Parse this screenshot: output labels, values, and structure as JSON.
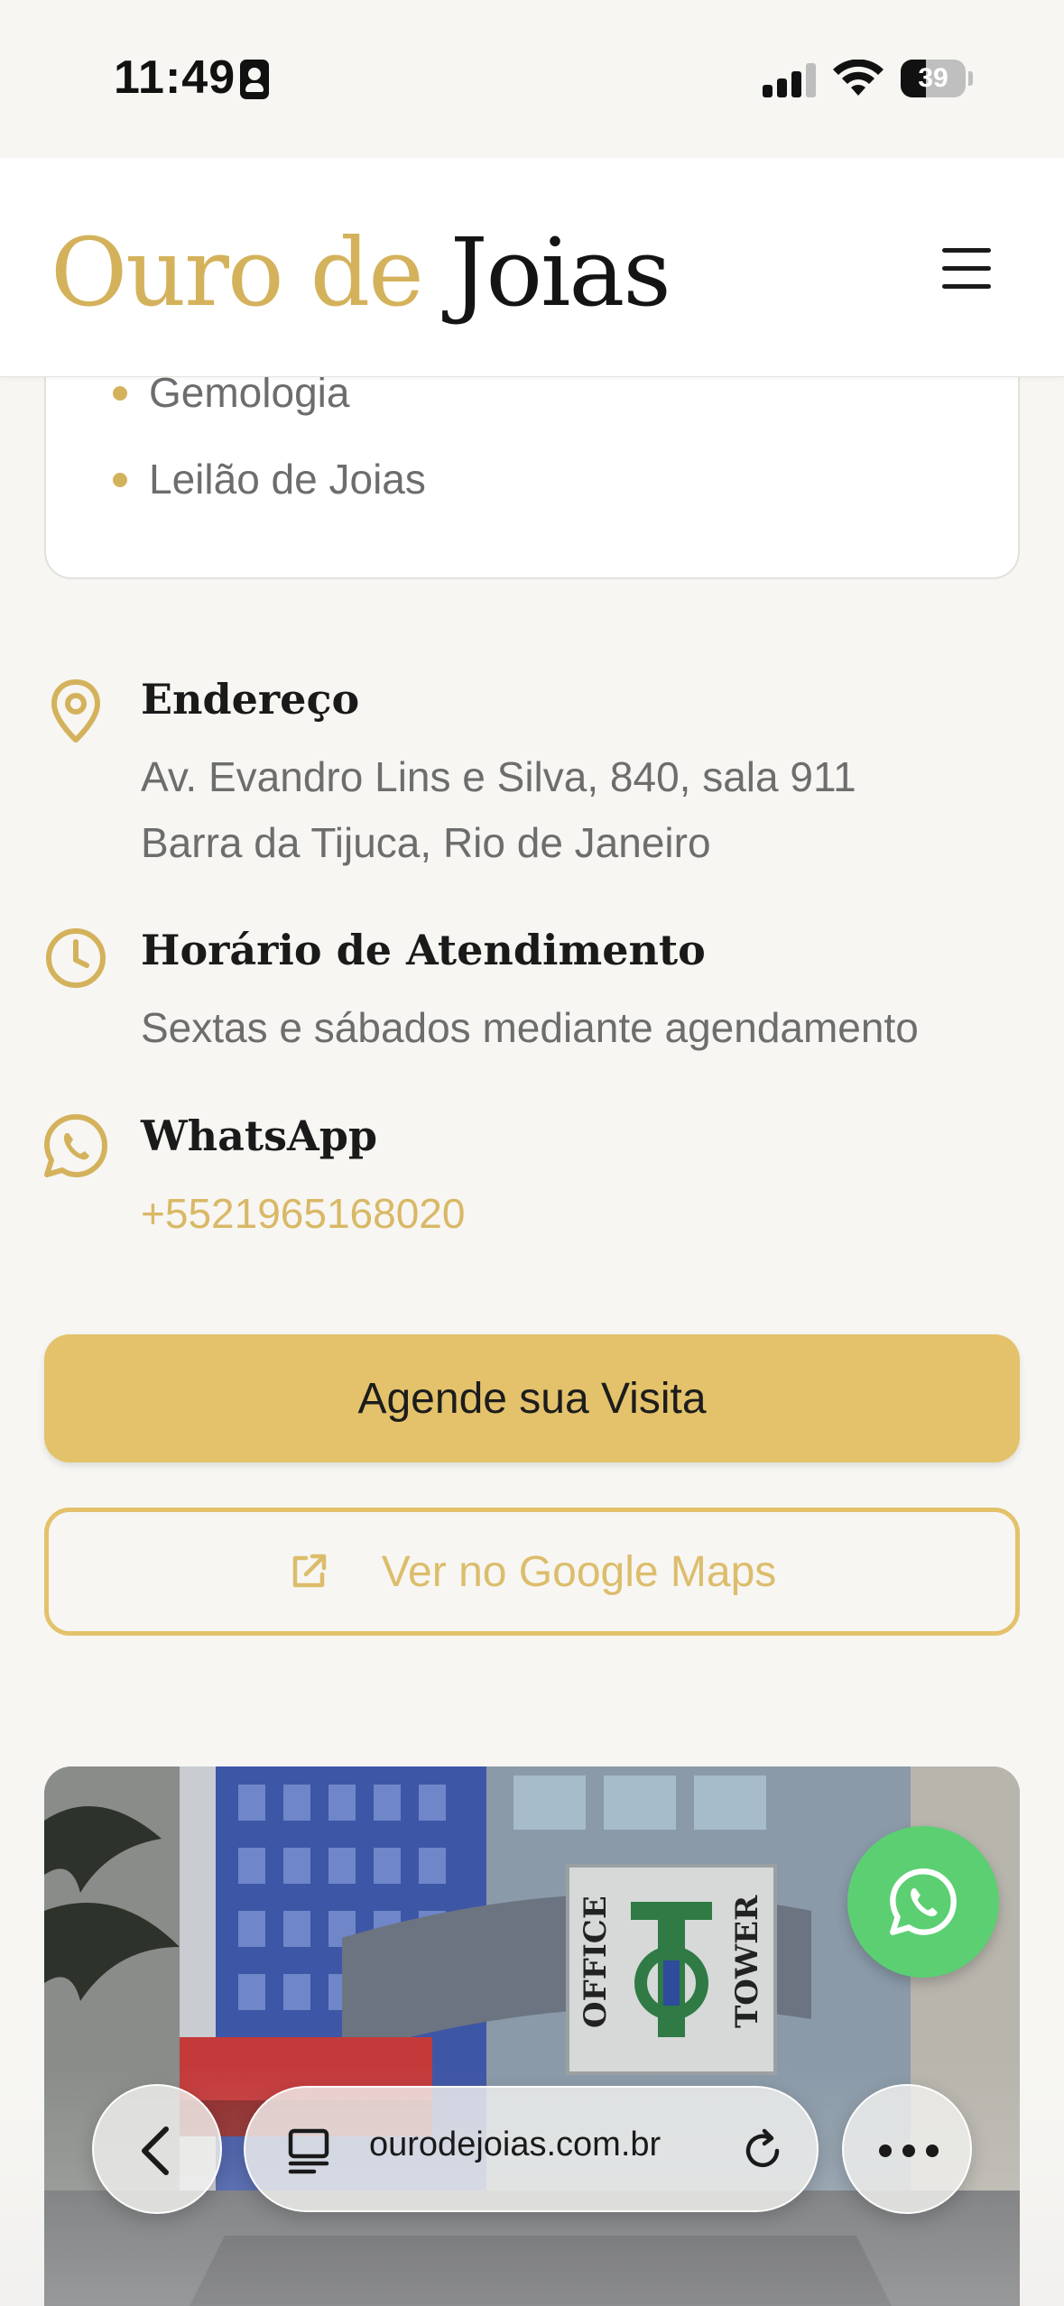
{
  "status_bar": {
    "time": "11:49",
    "battery": "39"
  },
  "header": {
    "logo_part1": "Ouro de",
    "logo_part2": "Joias"
  },
  "services": [
    {
      "label": "Gemologia"
    },
    {
      "label": "Leilão de Joias"
    }
  ],
  "address": {
    "title": "Endereço",
    "line1": "Av. Evandro Lins e Silva, 840, sala 911",
    "line2": "Barra da Tijuca, Rio de Janeiro"
  },
  "hours": {
    "title": "Horário de Atendimento",
    "text": "Sextas e sábados mediante agendamento"
  },
  "whatsapp": {
    "title": "WhatsApp",
    "number": "+5521965168020"
  },
  "buttons": {
    "schedule": "Agende sua Visita",
    "maps": "Ver no Google Maps"
  },
  "photo": {
    "sign_left": "OFFICE",
    "sign_right": "TOWER"
  },
  "browser": {
    "url": "ourodejoias.com.br"
  },
  "colors": {
    "gold": "#d4b25c",
    "button_gold": "#e3c26b",
    "whatsapp_green": "#5ccf72",
    "background": "#f7f6f3"
  }
}
